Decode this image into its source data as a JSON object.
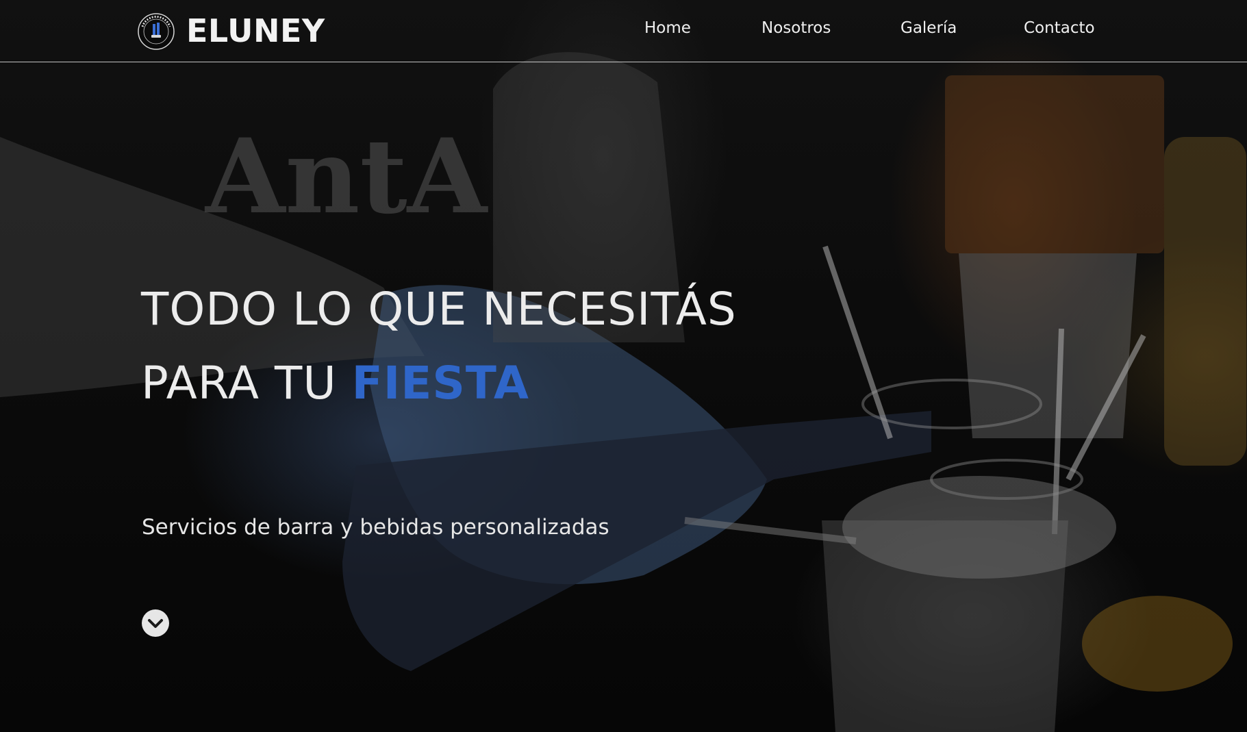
{
  "header": {
    "brand": "ELUNEY",
    "logo_text": "SERVICIOS ELUNEY"
  },
  "nav": {
    "items": [
      {
        "label": "Home"
      },
      {
        "label": "Nosotros"
      },
      {
        "label": "Galería"
      },
      {
        "label": "Contacto"
      }
    ]
  },
  "hero": {
    "headline_line1": "TODO LO QUE NECESITÁS",
    "headline_line2_prefix": "PARA TU",
    "headline_line2_accent": "FIESTA",
    "subtitle": "Servicios de barra y bebidas personalizadas",
    "scroll_icon": "chevron-down-icon"
  },
  "colors": {
    "accent": "#2f66c9",
    "text": "#ececec",
    "background": "#0a0a0a"
  }
}
